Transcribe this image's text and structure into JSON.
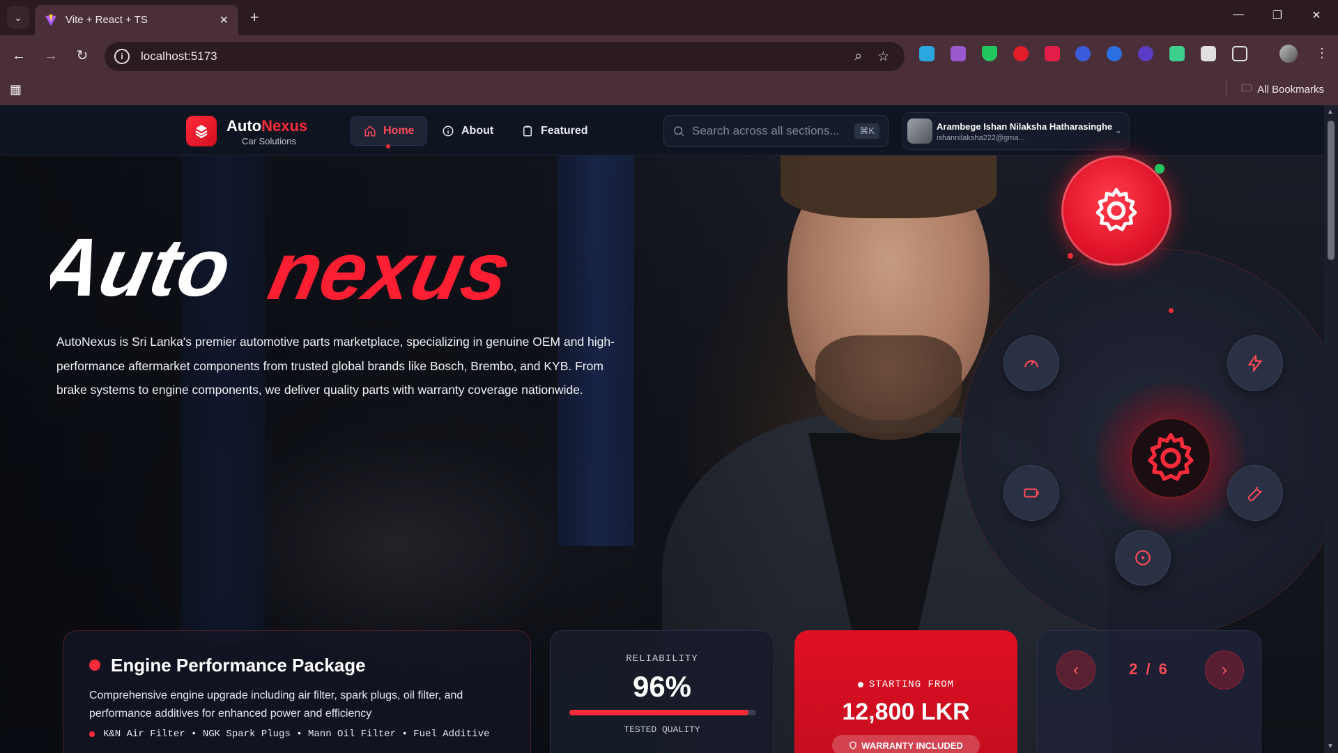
{
  "browser": {
    "tab_title": "Vite + React + TS",
    "url": "localhost:5173",
    "all_bookmarks": "All Bookmarks",
    "extensions": [
      "#2aa7e0",
      "#9b59d0",
      "#22c55e",
      "#e11d2a",
      "#e11d48",
      "#3b5bdb",
      "#2c6fe0",
      "#5b3cc4",
      "#3ccf8e",
      "#e0e0e0"
    ]
  },
  "nav": {
    "brand_auto": "Auto",
    "brand_nexus": "Nexus",
    "brand_sub": "Car Solutions",
    "links": [
      {
        "label": "Home",
        "active": true
      },
      {
        "label": "About",
        "active": false
      },
      {
        "label": "Featured",
        "active": false
      }
    ],
    "search_placeholder": "Search across all sections...",
    "search_shortcut": "⌘K",
    "user_name": "Arambege Ishan Nilaksha Hatharasinghe",
    "user_email": "ishannilaksha222@gma..."
  },
  "hero": {
    "logo_auto": "Auto",
    "logo_nexus": "nexus",
    "description": "AutoNexus is Sri Lanka's premier automotive parts marketplace, specializing in genuine OEM and high-performance aftermarket components from trusted global brands like Bosch, Brembo, and KYB. From brake systems to engine components, we deliver quality parts with warranty coverage nationwide."
  },
  "orbit": {
    "icons": [
      "gear-icon",
      "speedometer-icon",
      "lightning-icon",
      "battery-icon",
      "wrench-icon",
      "target-icon"
    ]
  },
  "package": {
    "title": "Engine Performance Package",
    "description": "Comprehensive engine upgrade including air filter, spark plugs, oil filter, and performance additives for enhanced power and efficiency",
    "parts": "K&N Air Filter • NGK Spark Plugs • Mann Oil Filter • Fuel Additive"
  },
  "reliability": {
    "label": "RELIABILITY",
    "value": "96%",
    "fill_percent": 96,
    "sublabel": "TESTED QUALITY"
  },
  "price": {
    "label": "STARTING FROM",
    "value": "12,800 LKR",
    "warranty": "WARRANTY INCLUDED"
  },
  "pager": {
    "count": "2 / 6"
  },
  "colors": {
    "accent": "#ff2a3a",
    "nav_bg": "#0f1421",
    "chrome_bg": "#4a2f39"
  }
}
